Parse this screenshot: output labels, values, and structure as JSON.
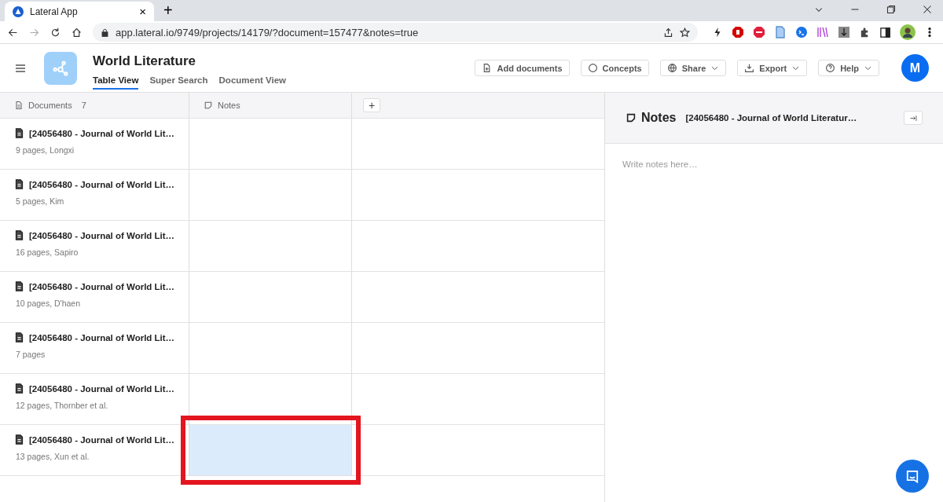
{
  "browser": {
    "tab_title": "Lateral App",
    "tab_close": "×",
    "new_tab": "+",
    "url": "app.lateral.io/9749/projects/14179/?document=157477&notes=true"
  },
  "header": {
    "title": "World Literature",
    "avatar": "M",
    "views": [
      {
        "label": "Table View",
        "selected": true
      },
      {
        "label": "Super Search",
        "selected": false
      },
      {
        "label": "Document View",
        "selected": false
      }
    ],
    "actions": [
      {
        "label": "Add documents",
        "kind": "add",
        "dropdown": false
      },
      {
        "label": "Concepts",
        "kind": "concepts",
        "dropdown": false
      },
      {
        "label": "Share",
        "kind": "share",
        "dropdown": true
      },
      {
        "label": "Export",
        "kind": "export",
        "dropdown": true
      },
      {
        "label": "Help",
        "kind": "help",
        "dropdown": true
      }
    ]
  },
  "table": {
    "columns": [
      {
        "label": "Documents",
        "count": "7",
        "kind": "documents"
      },
      {
        "label": "Notes",
        "kind": "notes"
      }
    ],
    "add_column": "+",
    "rows": [
      {
        "title": "[24056480 - Journal of World Lit…",
        "meta": "9 pages, Longxi",
        "selected": false
      },
      {
        "title": "[24056480 - Journal of World Lit…",
        "meta": "5 pages, Kim",
        "selected": false
      },
      {
        "title": "[24056480 - Journal of World Lit…",
        "meta": "16 pages, Sapiro",
        "selected": false
      },
      {
        "title": "[24056480 - Journal of World Lit…",
        "meta": "10 pages, D'haen",
        "selected": false
      },
      {
        "title": "[24056480 - Journal of World Lit…",
        "meta": "7 pages",
        "selected": false
      },
      {
        "title": "[24056480 - Journal of World Lit…",
        "meta": "12 pages, Thornber et al.",
        "selected": false
      },
      {
        "title": "[24056480 - Journal of World Lit…",
        "meta": "13 pages, Xun et al.",
        "selected": true
      }
    ]
  },
  "notes_panel": {
    "title": "Notes",
    "document": "[24056480 - Journal of World Literatur…",
    "placeholder": "Write notes here…"
  }
}
